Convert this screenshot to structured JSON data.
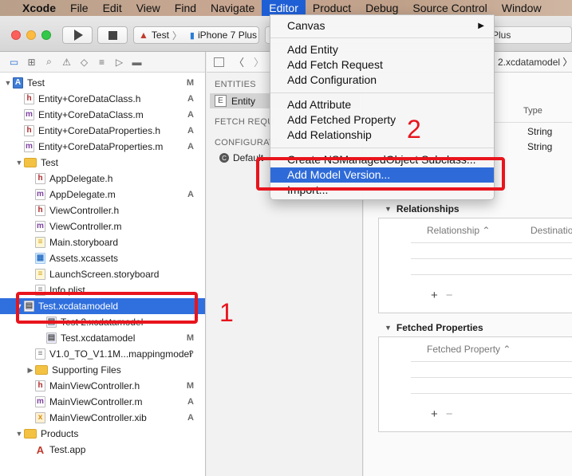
{
  "menubar": {
    "apple_icon": "apple-logo",
    "items": [
      "Xcode",
      "File",
      "Edit",
      "View",
      "Find",
      "Navigate",
      "Editor",
      "Product",
      "Debug",
      "Source Control",
      "Window"
    ],
    "active": "Editor"
  },
  "toolbar": {
    "scheme": "Test",
    "device": "iPhone 7 Plus",
    "activity_text": "Plus"
  },
  "navigator": {
    "tabs": [
      "folder-icon",
      "hierarchy-icon",
      "search-icon",
      "warning-icon",
      "test-icon",
      "debug-icon",
      "breakpoint-icon",
      "report-icon"
    ],
    "rows": [
      {
        "label": "Test",
        "status": "M",
        "icon": "project",
        "glyph": "A",
        "indent": 0,
        "disc": "▼"
      },
      {
        "label": "Entity+CoreDataClass.h",
        "status": "A",
        "icon": "h",
        "glyph": "h",
        "indent": 1,
        "disc": ""
      },
      {
        "label": "Entity+CoreDataClass.m",
        "status": "A",
        "icon": "m",
        "glyph": "m",
        "indent": 1,
        "disc": ""
      },
      {
        "label": "Entity+CoreDataProperties.h",
        "status": "A",
        "icon": "h",
        "glyph": "h",
        "indent": 1,
        "disc": ""
      },
      {
        "label": "Entity+CoreDataProperties.m",
        "status": "A",
        "icon": "m",
        "glyph": "m",
        "indent": 1,
        "disc": ""
      },
      {
        "label": "Test",
        "status": "",
        "icon": "folder",
        "glyph": "",
        "indent": 1,
        "disc": "▼"
      },
      {
        "label": "AppDelegate.h",
        "status": "",
        "icon": "h",
        "glyph": "h",
        "indent": 2,
        "disc": ""
      },
      {
        "label": "AppDelegate.m",
        "status": "A",
        "icon": "m",
        "glyph": "m",
        "indent": 2,
        "disc": ""
      },
      {
        "label": "ViewController.h",
        "status": "",
        "icon": "h",
        "glyph": "h",
        "indent": 2,
        "disc": ""
      },
      {
        "label": "ViewController.m",
        "status": "",
        "icon": "m",
        "glyph": "m",
        "indent": 2,
        "disc": ""
      },
      {
        "label": "Main.storyboard",
        "status": "",
        "icon": "sb",
        "glyph": "≡",
        "indent": 2,
        "disc": ""
      },
      {
        "label": "Assets.xcassets",
        "status": "",
        "icon": "xc",
        "glyph": "▦",
        "indent": 2,
        "disc": ""
      },
      {
        "label": "LaunchScreen.storyboard",
        "status": "",
        "icon": "sb",
        "glyph": "≡",
        "indent": 2,
        "disc": ""
      },
      {
        "label": "Info.plist",
        "status": "",
        "icon": "pl",
        "glyph": "≡",
        "indent": 2,
        "disc": ""
      },
      {
        "label": "Test.xcdatamodeld",
        "status": "",
        "icon": "dm",
        "glyph": "▤",
        "indent": 1,
        "disc": "▼",
        "selected": true
      },
      {
        "label": "Test 2.xcdatamodel",
        "status": "",
        "icon": "dm",
        "glyph": "▤",
        "indent": 3,
        "disc": ""
      },
      {
        "label": "Test.xcdatamodel",
        "status": "M",
        "icon": "dm",
        "glyph": "▤",
        "indent": 3,
        "disc": ""
      },
      {
        "label": "V1.0_TO_V1.1M...mappingmodel",
        "status": "?",
        "icon": "map",
        "glyph": "≡",
        "indent": 2,
        "disc": ""
      },
      {
        "label": "Supporting Files",
        "status": "",
        "icon": "folder",
        "glyph": "",
        "indent": 2,
        "disc": "▶"
      },
      {
        "label": "MainViewController.h",
        "status": "M",
        "icon": "h",
        "glyph": "h",
        "indent": 2,
        "disc": ""
      },
      {
        "label": "MainViewController.m",
        "status": "A",
        "icon": "m",
        "glyph": "m",
        "indent": 2,
        "disc": ""
      },
      {
        "label": "MainViewController.xib",
        "status": "A",
        "icon": "xib",
        "glyph": "x",
        "indent": 2,
        "disc": ""
      },
      {
        "label": "Products",
        "status": "",
        "icon": "folder",
        "glyph": "",
        "indent": 1,
        "disc": "▼"
      },
      {
        "label": "Test.app",
        "status": "",
        "icon": "app",
        "glyph": "A",
        "indent": 2,
        "disc": ""
      }
    ]
  },
  "outline": {
    "entities_header": "ENTITIES",
    "entity": "Entity",
    "fetch_header": "FETCH REQU",
    "config_header": "CONFIGURATI",
    "config_item": "Default",
    "jump_path": "2.xcdatamodel"
  },
  "editor": {
    "type_header": "Type",
    "attr_types": [
      "String",
      "String"
    ],
    "relationships_title": "Relationships",
    "relationship_col": "Relationship",
    "destination_col": "Destinatio",
    "fetched_title": "Fetched Properties",
    "fetched_col": "Fetched Property",
    "plus": "+",
    "minus": "−"
  },
  "menu": {
    "canvas": "Canvas",
    "add_entity": "Add Entity",
    "add_fetch_request": "Add Fetch Request",
    "add_configuration": "Add Configuration",
    "add_attribute": "Add Attribute",
    "add_fetched_property": "Add Fetched Property",
    "add_relationship": "Add Relationship",
    "create_subclass": "Create NSManagedObject Subclass...",
    "add_model_version": "Add Model Version...",
    "import": "Import..."
  },
  "annotations": {
    "one": "1",
    "two": "2",
    "color": "#e8141c"
  }
}
